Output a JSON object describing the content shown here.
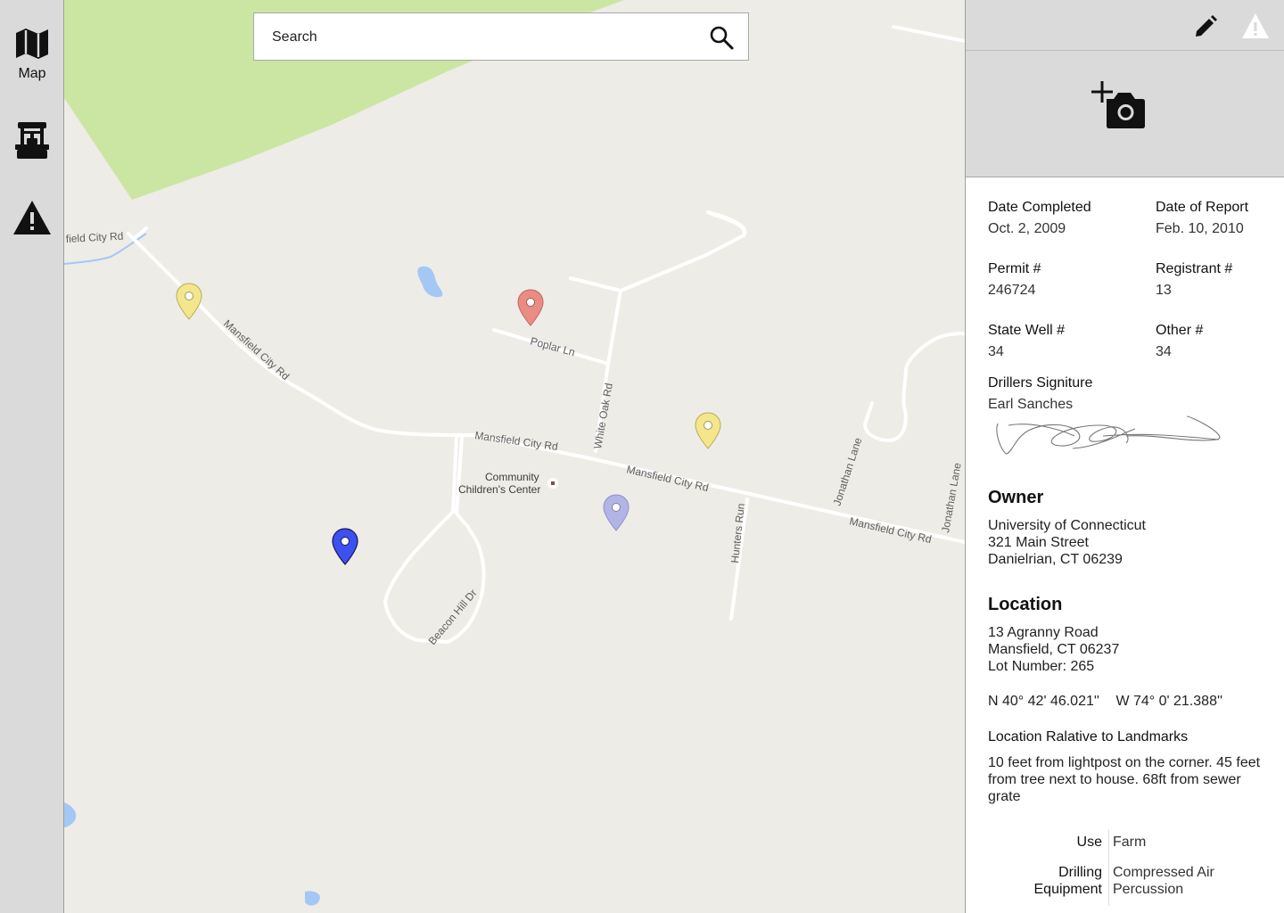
{
  "nav": {
    "map_label": "Map"
  },
  "search": {
    "placeholder": "Search"
  },
  "map": {
    "roads": {
      "mansfield_nw": "field City Rd",
      "mansfield_1": "Mansfield City Rd",
      "mansfield_2": "Mansfield City Rd",
      "mansfield_3": "Mansfield City Rd",
      "mansfield_4": "Mansfield City Rd",
      "poplar": "Poplar Ln",
      "white_oak": "White Oak Rd",
      "hunters": "Hunters Run",
      "jonathan_1": "Jonathan Lane",
      "jonathan_2": "Jonathan Lane",
      "beacon": "Beacon Hill Dr"
    },
    "poi": {
      "line1": "Community",
      "line2": "Children's Center"
    },
    "marker_colors": {
      "yellow": "#f3e68c",
      "red": "#e88c84",
      "lavender": "#b3b4e6",
      "blue": "#3d50f0"
    },
    "park_color": "#cbe6a3",
    "water_color": "#a4c8f5"
  },
  "panel": {
    "date_completed_label": "Date Completed",
    "date_completed": "Oct. 2, 2009",
    "date_report_label": "Date of Report",
    "date_report": "Feb. 10, 2010",
    "permit_label": "Permit #",
    "permit": "246724",
    "registrant_label": "Registrant #",
    "registrant": "13",
    "state_well_label": "State Well #",
    "state_well": "34",
    "other_label": "Other #",
    "other": "34",
    "signature_label": "Drillers Signiture",
    "signature_name": "Earl Sanches",
    "owner_title": "Owner",
    "owner_line1": "University of Connecticut",
    "owner_line2": "321 Main Street",
    "owner_line3": "Danielrian, CT 06239",
    "location_title": "Location",
    "location_line1": "13 Agranny Road",
    "location_line2": "Mansfield, CT 06237",
    "location_line3": "Lot Number: 265",
    "lat": "N 40° 42' 46.021''",
    "lon": "W 74° 0' 21.388''",
    "landmarks_title": "Location Ralative to Landmarks",
    "landmarks_text": "10 feet from lightpost on the corner. 45 feet from tree next to house. 68ft from sewer grate",
    "use_label": "Use",
    "use_value": "Farm",
    "drilling_label_1": "Drilling",
    "drilling_label_2": "Equipment",
    "drilling_value_1": "Compressed Air",
    "drilling_value_2": "Percussion"
  }
}
